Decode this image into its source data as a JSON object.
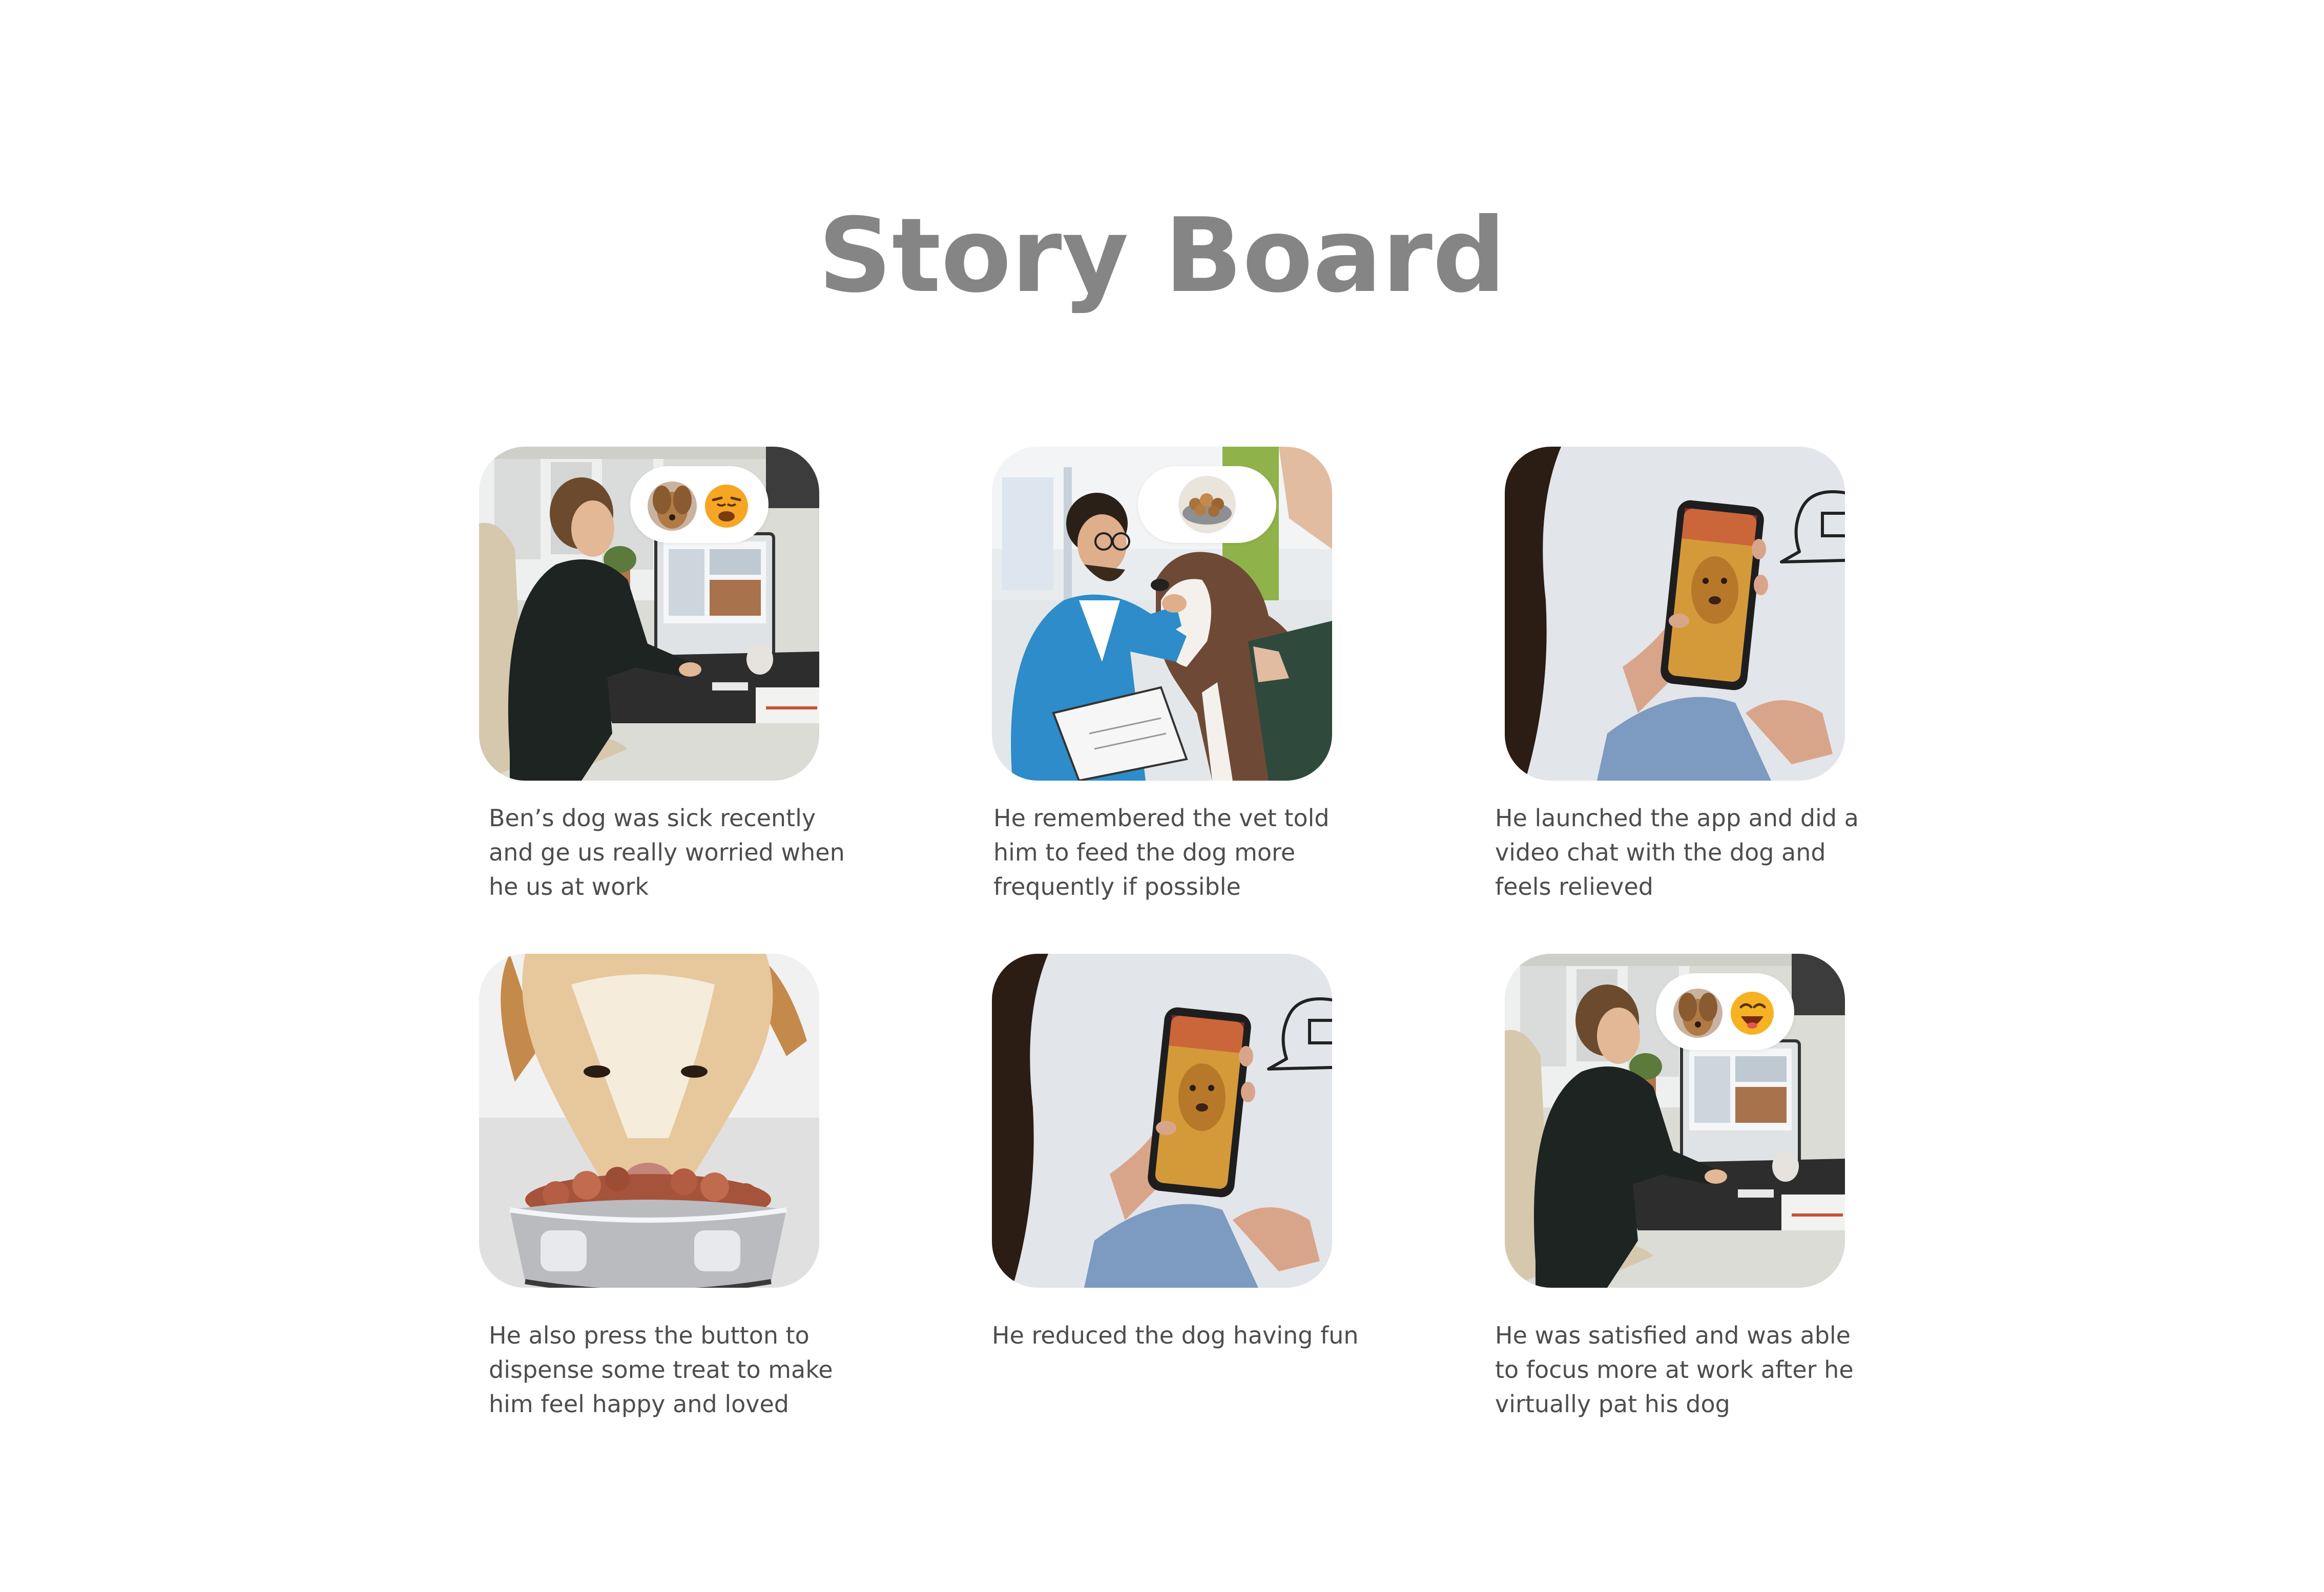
{
  "page": {
    "title": "Story Board"
  },
  "panels": [
    {
      "scene": "man-working-at-desk-worried",
      "emoji": [
        "dog-face-icon",
        "worried-face-icon"
      ],
      "caption": "Ben’s dog was sick recently and ge us really worried when he us at work"
    },
    {
      "scene": "vet-examining-dog",
      "emoji": [
        "dog-food-icon"
      ],
      "caption": "He remembered the vet told him to feed the dog more frequently if possible"
    },
    {
      "scene": "video-chat-with-dog-on-phone",
      "emoji": [
        "speech-bubble-icon"
      ],
      "caption": "He launched the app and did a video chat with the dog and feels relieved"
    },
    {
      "scene": "dog-eating-treats",
      "emoji": [],
      "caption": "He also press the button to dispense some treat to make him feel happy and loved"
    },
    {
      "scene": "video-chat-with-dog-on-phone",
      "emoji": [
        "speech-bubble-icon"
      ],
      "caption": "He reduced the dog having fun"
    },
    {
      "scene": "man-working-at-desk-happy",
      "emoji": [
        "dog-face-icon",
        "happy-face-icon"
      ],
      "caption": "He was satisfied and was able to focus more at work after he virtually pat his dog"
    }
  ]
}
